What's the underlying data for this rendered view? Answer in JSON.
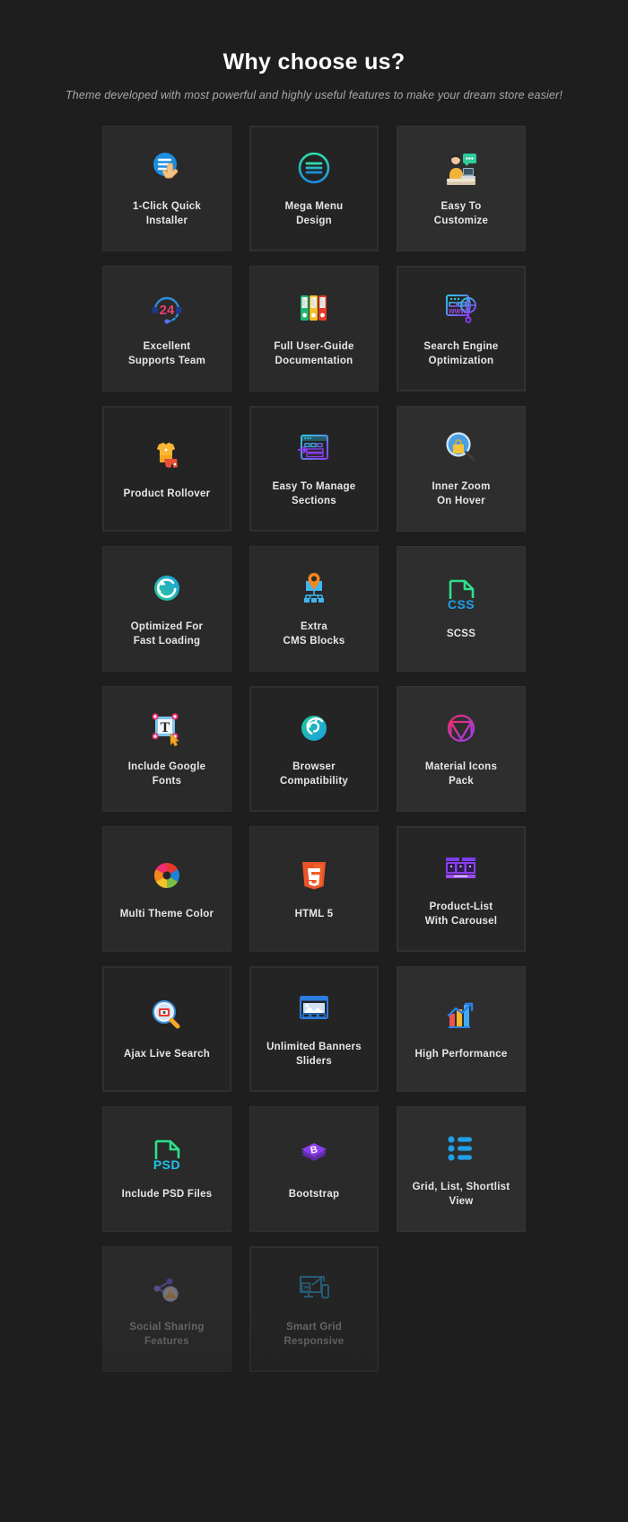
{
  "header": {
    "title": "Why choose us?",
    "subtitle": "Theme developed with most powerful and highly  useful features to make your dream store easier!"
  },
  "colors": {
    "page_background": "#1e1e1e",
    "card_background": "#2a2a2a",
    "card_border": "#303030",
    "title_text": "#ffffff",
    "subtitle_text": "#a9a9a9",
    "label_text": "#e6e6e6",
    "faded_label_text": "#6d6d6d"
  },
  "features": [
    {
      "label": "1-Click Quick\nInstaller",
      "icon": "one-click-installer-icon",
      "variant": "v1",
      "faded": false
    },
    {
      "label": "Mega Menu\nDesign",
      "icon": "mega-menu-icon",
      "variant": "v2",
      "faded": false
    },
    {
      "label": "Easy To\nCustomize",
      "icon": "easy-customize-icon",
      "variant": "v3",
      "faded": false
    },
    {
      "label": "Excellent\nSupports Team",
      "icon": "support-24-icon",
      "variant": "v1",
      "faded": false
    },
    {
      "label": "Full User-Guide\nDocumentation",
      "icon": "documentation-icon",
      "variant": "v1",
      "faded": false
    },
    {
      "label": "Search Engine\nOptimization",
      "icon": "seo-icon",
      "variant": "v4",
      "faded": false
    },
    {
      "label": "Product Rollover",
      "icon": "product-rollover-icon",
      "variant": "v2",
      "faded": false
    },
    {
      "label": "Easy To Manage\nSections",
      "icon": "manage-sections-icon",
      "variant": "v2",
      "faded": false
    },
    {
      "label": "Inner Zoom\nOn Hover",
      "icon": "inner-zoom-icon",
      "variant": "v3",
      "faded": false
    },
    {
      "label": "Optimized For\nFast Loading",
      "icon": "fast-loading-icon",
      "variant": "v1",
      "faded": false
    },
    {
      "label": "Extra\nCMS Blocks",
      "icon": "cms-blocks-icon",
      "variant": "v1",
      "faded": false
    },
    {
      "label": "SCSS",
      "icon": "css-file-icon",
      "variant": "v3",
      "faded": false
    },
    {
      "label": "Include Google\nFonts",
      "icon": "google-fonts-icon",
      "variant": "v1",
      "faded": false
    },
    {
      "label": "Browser\nCompatibility",
      "icon": "browser-compat-icon",
      "variant": "v2",
      "faded": false
    },
    {
      "label": "Material Icons\nPack",
      "icon": "material-icons-icon",
      "variant": "v3",
      "faded": false
    },
    {
      "label": "Multi Theme Color",
      "icon": "color-wheel-icon",
      "variant": "v1",
      "faded": false
    },
    {
      "label": "HTML 5",
      "icon": "html5-icon",
      "variant": "v1",
      "faded": false
    },
    {
      "label": "Product-List\nWith Carousel",
      "icon": "product-carousel-icon",
      "variant": "v4",
      "faded": false
    },
    {
      "label": "Ajax Live Search",
      "icon": "ajax-search-icon",
      "variant": "v2",
      "faded": false
    },
    {
      "label": "Unlimited Banners\nSliders",
      "icon": "banner-slider-icon",
      "variant": "v2",
      "faded": false
    },
    {
      "label": "High Performance",
      "icon": "performance-chart-icon",
      "variant": "v3",
      "faded": false
    },
    {
      "label": "Include PSD Files",
      "icon": "psd-file-icon",
      "variant": "v1",
      "faded": false
    },
    {
      "label": "Bootstrap",
      "icon": "bootstrap-icon",
      "variant": "v1",
      "faded": false
    },
    {
      "label": "Grid, List, Shortlist\nView",
      "icon": "grid-list-view-icon",
      "variant": "v3",
      "faded": false
    },
    {
      "label": "Social Sharing\nFeatures",
      "icon": "social-sharing-icon",
      "variant": "v1",
      "faded": true
    },
    {
      "label": "Smart Grid\nResponsive",
      "icon": "smart-grid-icon",
      "variant": "v2",
      "faded": true
    }
  ]
}
